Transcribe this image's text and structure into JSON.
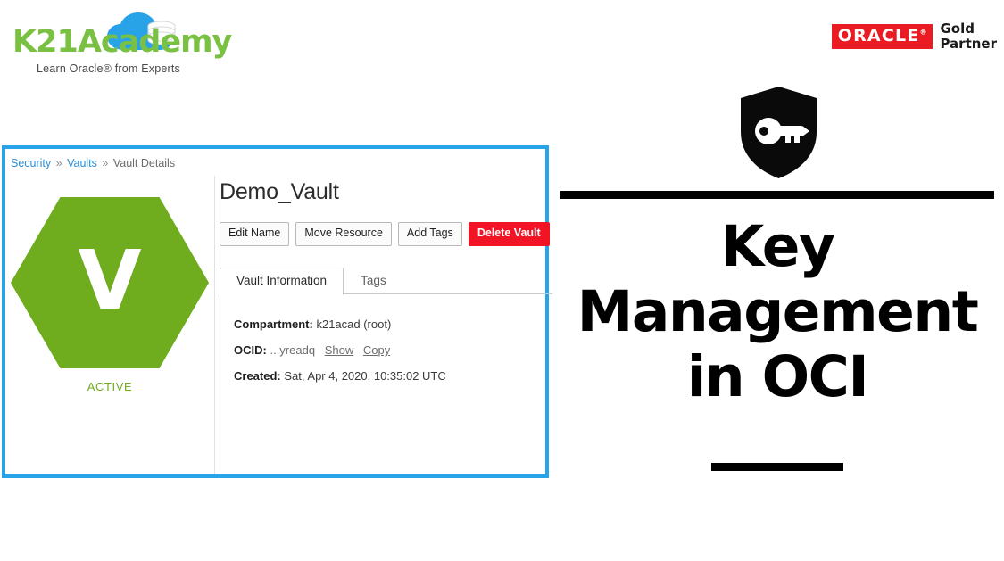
{
  "brand": {
    "wordmark": "K21Academy",
    "tagline": "Learn Oracle® from Experts",
    "cloud_icon": "cloud-database-icon",
    "green": "#7ac143",
    "blue": "#29a3e8"
  },
  "partner_badge": {
    "oracle_wordmark": "ORACLE",
    "registered_mark": "®",
    "line1": "Gold",
    "line2": "Partner",
    "red": "#ea1b22"
  },
  "console": {
    "border_color": "#29a3e8",
    "breadcrumb": {
      "items": [
        {
          "label": "Security",
          "link": true
        },
        {
          "label": "Vaults",
          "link": true
        },
        {
          "label": "Vault Details",
          "link": false
        }
      ],
      "separator": "»"
    },
    "status_badge": {
      "letter": "V",
      "status": "ACTIVE",
      "color": "#6fac1e",
      "shape": "hexagon"
    },
    "title": "Demo_Vault",
    "actions": [
      {
        "label": "Edit Name",
        "style": "default"
      },
      {
        "label": "Move Resource",
        "style": "default"
      },
      {
        "label": "Add Tags",
        "style": "default"
      },
      {
        "label": "Delete Vault",
        "style": "danger"
      }
    ],
    "tabs": [
      {
        "label": "Vault Information",
        "active": true
      },
      {
        "label": "Tags",
        "active": false
      }
    ],
    "details": [
      {
        "label": "Compartment:",
        "value": "k21acad (root)",
        "muted": false,
        "links": []
      },
      {
        "label": "OCID:",
        "value": "...yreadq",
        "muted": true,
        "links": [
          "Show",
          "Copy"
        ]
      },
      {
        "label": "Created:",
        "value": "Sat, Apr 4, 2020, 10:35:02 UTC",
        "muted": false,
        "links": []
      }
    ]
  },
  "hero": {
    "icon": "shield-key-icon",
    "title_line1": "Key",
    "title_line2": "Management",
    "title_line3": "in OCI",
    "rule_color": "#000000"
  }
}
